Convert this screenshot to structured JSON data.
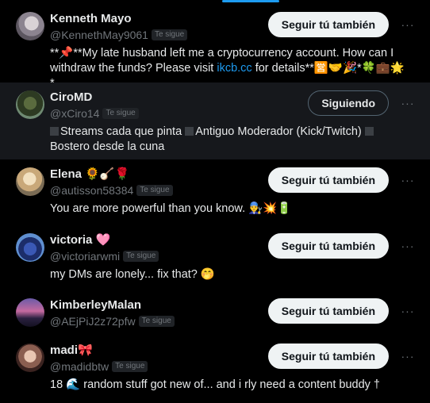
{
  "users": [
    {
      "name": "Kenneth Mayo",
      "handle": "@KennethMay9061",
      "follows_you": "Te sigue",
      "button": "Seguir tú también",
      "bio_parts": [
        "**📌**My late husband left me a cryptocurrency account. How can I withdraw the funds? Please visit ",
        "ikcb.cc",
        " for details**🈺🤝🎉*🍀💼🌟*"
      ]
    },
    {
      "name": "CiroMD",
      "handle": "@xCiro14",
      "follows_you": "Te sigue",
      "button": "Siguiendo",
      "bio": "Streams cada que pinta",
      "bio2": "Antiguo Moderador (Kick/Twitch)",
      "bio3": "Bostero desde la cuna"
    },
    {
      "name": "Elena 🌻🪕🌹",
      "handle": "@autisson58384",
      "follows_you": "Te sigue",
      "button": "Seguir tú también",
      "bio": "You are more powerful than you know. 👨‍🔧💥🔋"
    },
    {
      "name": "victoria 🩷",
      "handle": "@victoriarwmi",
      "follows_you": "Te sigue",
      "button": "Seguir tú también",
      "bio": "my DMs are lonely... fix that? 🤭"
    },
    {
      "name": "KimberleyMalan",
      "handle": "@AEjPiJ2z72pfw",
      "follows_you": "Te sigue",
      "button": "Seguir tú también"
    },
    {
      "name": "madi🎀",
      "handle": "@madidbtw",
      "follows_you": "Te sigue",
      "button": "Seguir tú también",
      "bio": "18 🌊 random stuff got new of... and i rly need a content buddy †"
    }
  ],
  "more_icon": "···",
  "colors": {
    "link": "#1d9bf0",
    "accent": "#1d9bf0",
    "background": "#000000",
    "row_hover": "#16181c"
  }
}
